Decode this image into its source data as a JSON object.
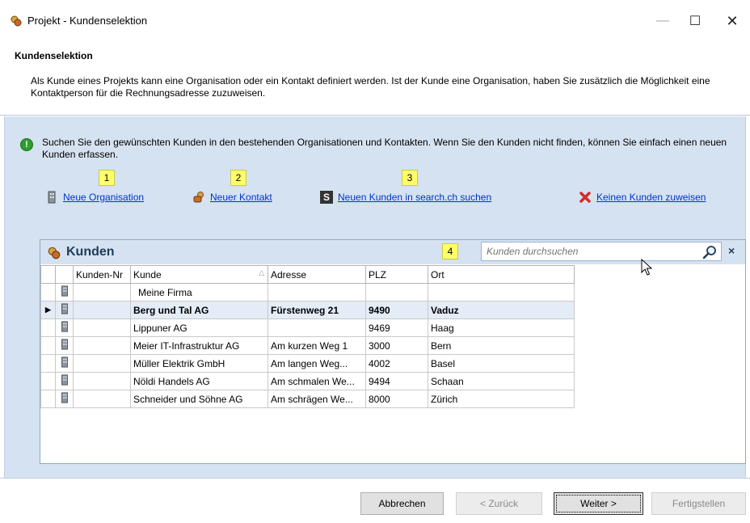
{
  "window": {
    "title": "Projekt - Kundenselektion",
    "min_glyph": "—",
    "max_glyph": "☐",
    "close_glyph": "✕"
  },
  "header": {
    "title": "Kundenselektion",
    "description": "Als Kunde eines Projekts kann eine Organisation oder ein Kontakt definiert werden. Ist der Kunde eine Organisation, haben Sie zusätzlich die Möglichkeit eine Kontaktperson für die Rechnungsadresse zuzuweisen."
  },
  "info": {
    "icon": "info-icon",
    "glyph": "!",
    "text": "Suchen Sie den gewünschten Kunden in den bestehenden Organisationen und Kontakten. Wenn Sie den Kunden nicht finden, können Sie einfach einen neuen Kunden erfassen."
  },
  "badges": [
    "1",
    "2",
    "3",
    "4"
  ],
  "actions": {
    "new_organisation": "Neue Organisation",
    "new_contact": "Neuer Kontakt",
    "search_ch": "Neuen Kunden in search.ch suchen",
    "search_ch_glyph": "S",
    "no_customer": "Keinen Kunden zuweisen"
  },
  "grid": {
    "title": "Kunden",
    "search_placeholder": "Kunden durchsuchen",
    "clear_glyph": "×",
    "sort_glyph": "△",
    "columns": [
      "Kunden-Nr",
      "Kunde",
      "Adresse",
      "PLZ",
      "Ort"
    ],
    "rows": [
      {
        "nr": "",
        "kunde": "Meine Firma",
        "adresse": "",
        "plz": "",
        "ort": "",
        "selected": false
      },
      {
        "nr": "",
        "kunde": "Berg und Tal AG",
        "adresse": "Fürstenweg 21",
        "plz": "9490",
        "ort": "Vaduz",
        "selected": true
      },
      {
        "nr": "",
        "kunde": "Lippuner AG",
        "adresse": "",
        "plz": "9469",
        "ort": "Haag",
        "selected": false
      },
      {
        "nr": "",
        "kunde": "Meier IT-Infrastruktur AG",
        "adresse": "Am kurzen Weg 1",
        "plz": "3000",
        "ort": "Bern",
        "selected": false
      },
      {
        "nr": "",
        "kunde": "Müller Elektrik GmbH",
        "adresse": "Am langen Weg...",
        "plz": "4002",
        "ort": "Basel",
        "selected": false
      },
      {
        "nr": "",
        "kunde": "Nöldi Handels AG",
        "adresse": "Am schmalen We...",
        "plz": "9494",
        "ort": "Schaan",
        "selected": false
      },
      {
        "nr": "",
        "kunde": "Schneider und Söhne AG",
        "adresse": "Am schrägen We...",
        "plz": "8000",
        "ort": "Zürich",
        "selected": false
      }
    ]
  },
  "footer": {
    "cancel": "Abbrechen",
    "back": "< Zurück",
    "next": "Weiter >",
    "finish": "Fertigstellen"
  },
  "colors": {
    "panel_bg": "#d5e2f1",
    "link": "#0033cc",
    "badge": "#ffff66",
    "selected_row": "#e4ecf7"
  }
}
